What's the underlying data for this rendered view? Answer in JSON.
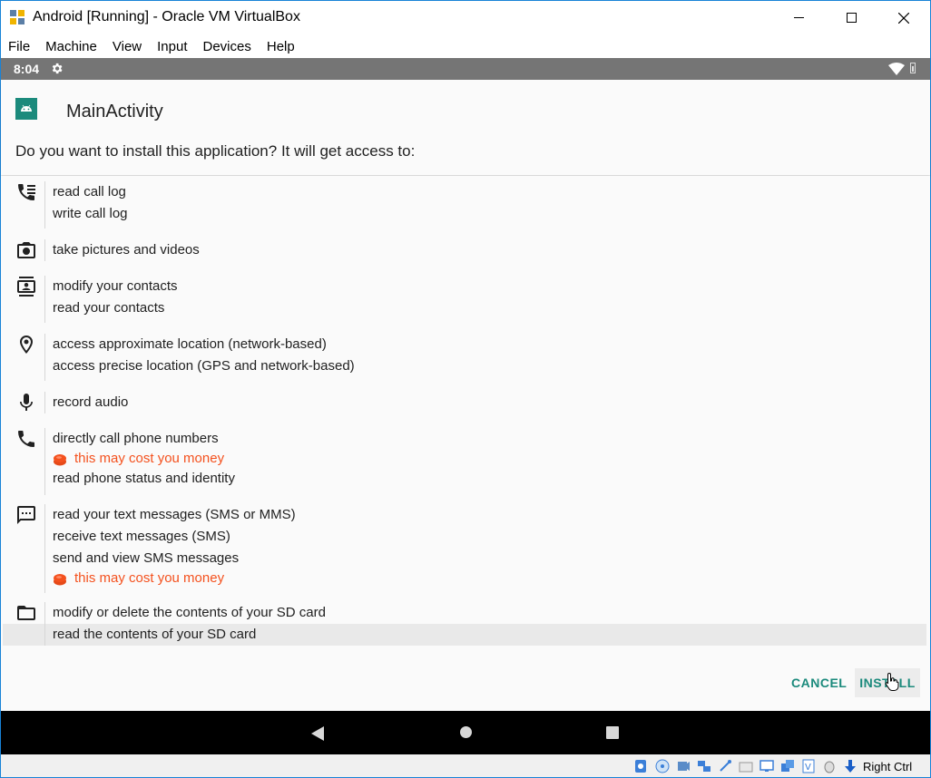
{
  "window": {
    "title": "Android [Running] - Oracle VM VirtualBox",
    "controls": [
      "minimize",
      "maximize",
      "close"
    ]
  },
  "menubar": {
    "items": [
      "File",
      "Machine",
      "View",
      "Input",
      "Devices",
      "Help"
    ]
  },
  "android_status": {
    "time": "8:04"
  },
  "header": {
    "app_name": "MainActivity",
    "question": "Do you want to install this application? It will get access to:"
  },
  "permissions": [
    {
      "icon": "call-log-icon",
      "lines": [
        {
          "text": "read call log"
        },
        {
          "text": "write call log"
        }
      ]
    },
    {
      "icon": "camera-icon",
      "lines": [
        {
          "text": "take pictures and videos"
        }
      ]
    },
    {
      "icon": "contacts-icon",
      "lines": [
        {
          "text": "modify your contacts"
        },
        {
          "text": "read your contacts"
        }
      ]
    },
    {
      "icon": "location-pin-icon",
      "lines": [
        {
          "text": "access approximate location (network-based)"
        },
        {
          "text": "access precise location (GPS and network-based)"
        }
      ]
    },
    {
      "icon": "microphone-icon",
      "lines": [
        {
          "text": "record audio"
        }
      ]
    },
    {
      "icon": "phone-icon",
      "lines": [
        {
          "text": "directly call phone numbers"
        },
        {
          "text": "this may cost you money",
          "warning": true
        },
        {
          "text": "read phone status and identity"
        }
      ]
    },
    {
      "icon": "sms-icon",
      "lines": [
        {
          "text": "read your text messages (SMS or MMS)"
        },
        {
          "text": "receive text messages (SMS)"
        },
        {
          "text": "send and view SMS messages"
        },
        {
          "text": "this may cost you money",
          "warning": true
        }
      ]
    },
    {
      "icon": "folder-icon",
      "lines": [
        {
          "text": "modify or delete the contents of your SD card"
        },
        {
          "text": "read the contents of your SD card",
          "highlighted": true
        }
      ]
    }
  ],
  "buttons": {
    "cancel": "CANCEL",
    "install": "INSTALL"
  },
  "vbox_status": {
    "host_key": "Right Ctrl"
  },
  "colors": {
    "accent": "#1b8a7c",
    "warning": "#f4511e",
    "status_bar": "#757575",
    "nav_bar": "#000000"
  }
}
